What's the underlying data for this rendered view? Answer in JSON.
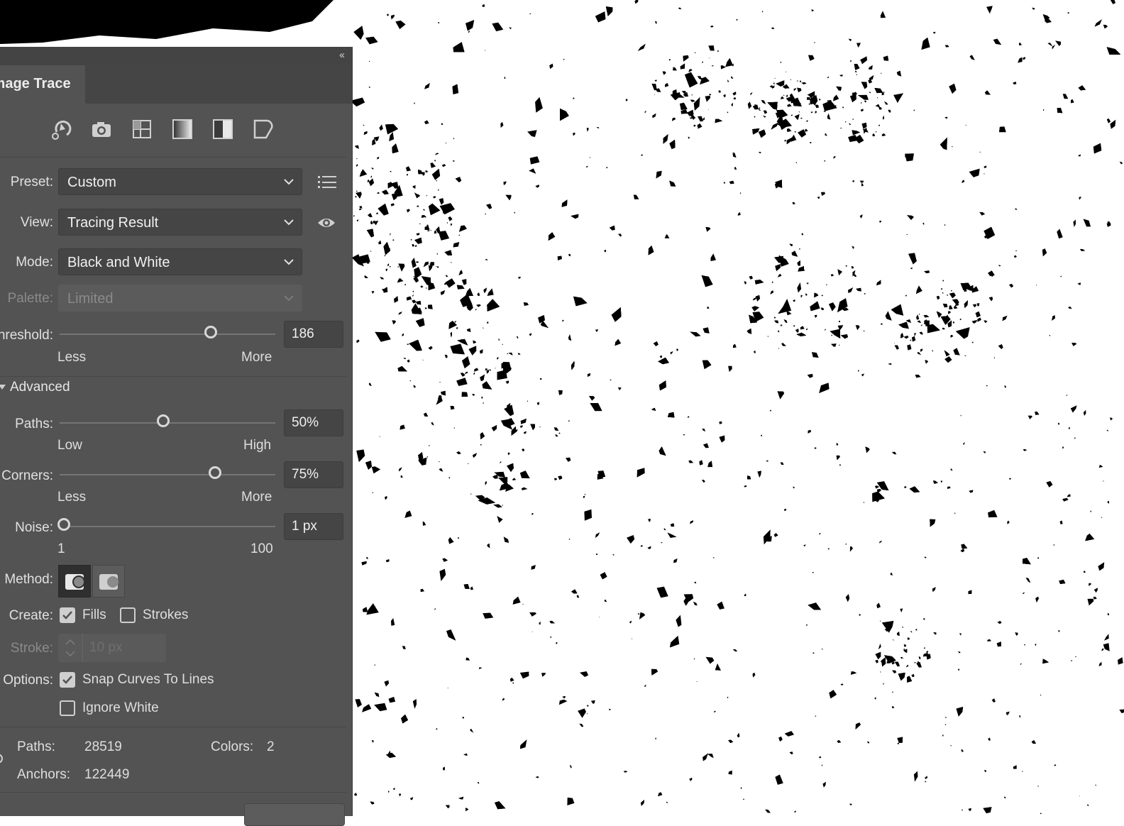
{
  "panel": {
    "tab_title": "Image Trace",
    "collapse_glyph": "‹‹",
    "icons": [
      "auto-color-icon",
      "high-color-icon",
      "low-color-icon",
      "grayscale-icon",
      "black-and-white-icon",
      "outline-icon"
    ],
    "preset": {
      "label": "Preset:",
      "value": "Custom"
    },
    "view": {
      "label": "View:",
      "value": "Tracing Result"
    },
    "mode": {
      "label": "Mode:",
      "value": "Black and White"
    },
    "palette": {
      "label": "Palette:",
      "value": "Limited"
    },
    "threshold": {
      "label": "Threshold:",
      "value": "186",
      "fraction": 0.71,
      "min_label": "Less",
      "max_label": "More"
    },
    "advanced_label": "Advanced",
    "paths": {
      "label": "Paths:",
      "value": "50%",
      "fraction": 0.49,
      "min_label": "Low",
      "max_label": "High"
    },
    "corners": {
      "label": "Corners:",
      "value": "75%",
      "fraction": 0.73,
      "min_label": "Less",
      "max_label": "More"
    },
    "noise": {
      "label": "Noise:",
      "value": "1 px",
      "fraction": 0.03,
      "min_label": "1",
      "max_label": "100"
    },
    "method_label": "Method:",
    "create": {
      "label": "Create:",
      "fills": "Fills",
      "fills_checked": true,
      "strokes": "Strokes",
      "strokes_checked": false
    },
    "stroke": {
      "label": "Stroke:",
      "value": "10 px"
    },
    "options": {
      "label": "Options:",
      "snap": "Snap Curves To Lines",
      "snap_checked": true,
      "ignore": "Ignore White",
      "ignore_checked": false
    },
    "stats": {
      "paths_label": "Paths:",
      "paths_value": "28519",
      "colors_label": "Colors:",
      "colors_value": "2",
      "anchors_label": "Anchors:",
      "anchors_value": "122449"
    }
  },
  "colors": {
    "panel_bg": "#535353",
    "canvas_bg": "#ffffff",
    "ink": "#000000"
  }
}
